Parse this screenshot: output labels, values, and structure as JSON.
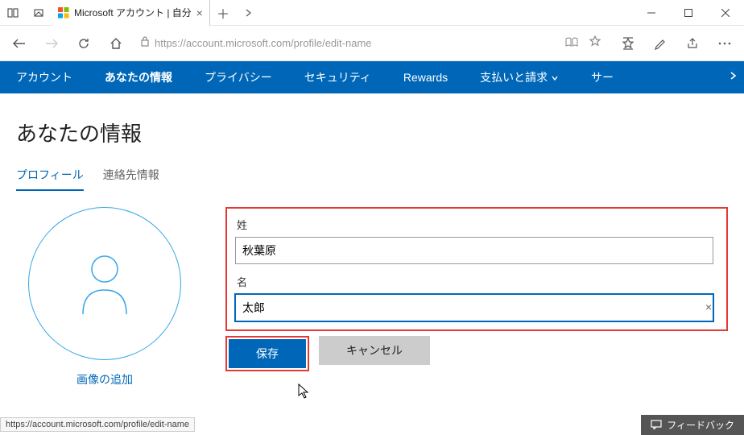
{
  "window": {
    "tab_title": "Microsoft アカウント | 自分",
    "url": "https://account.microsoft.com/profile/edit-name"
  },
  "bluenav": {
    "items": [
      "アカウント",
      "あなたの情報",
      "プライバシー",
      "セキュリティ",
      "Rewards",
      "支払いと請求",
      "サー"
    ]
  },
  "page": {
    "title": "あなたの情報",
    "tabs": {
      "profile": "プロフィール",
      "contact": "連絡先情報"
    },
    "add_image": "画像の追加"
  },
  "form": {
    "last_name_label": "姓",
    "last_name_value": "秋葉原",
    "first_name_label": "名",
    "first_name_value": "太郎",
    "save": "保存",
    "cancel": "キャンセル"
  },
  "status": {
    "url": "https://account.microsoft.com/profile/edit-name",
    "feedback": "フィードバック"
  }
}
